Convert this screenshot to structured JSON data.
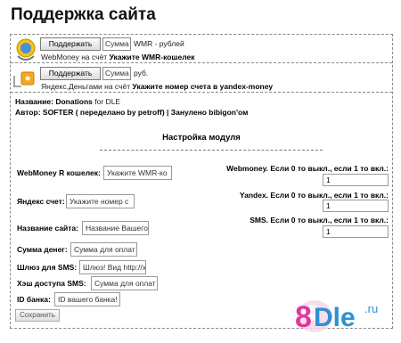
{
  "page": {
    "title": "Поддержка сайта"
  },
  "webmoney_pay": {
    "button": "Поддержать",
    "sum_placeholder": "Сумма",
    "currency": "WMR - рублей",
    "desc_prefix": "WebMoney на счёт",
    "desc_target": "Укажите WMR-кошелек",
    "icon": "webmoney-icon"
  },
  "yandex_pay": {
    "button": "Поддержать",
    "sum_placeholder": "Сумма",
    "currency": "руб.",
    "desc_prefix": "Яндекс.Деньгами на счёт",
    "desc_target": "Укажите номер счета в yandex-money",
    "icon": "yandex-money-icon"
  },
  "meta": {
    "name_label": "Название",
    "name_value": "Donations",
    "name_suffix": "for DLE",
    "author_label": "Автор",
    "author_value": "SOFTER ( переделано by petroff) | Зануленo bibigon'ом"
  },
  "settings": {
    "title": "Настройка модуля",
    "left_fields": [
      {
        "label": "WebMoney R кошелек:",
        "value": "Укажите WMR-ко"
      },
      {
        "label": "Яндекс счет:",
        "value": "Укажите номер с"
      },
      {
        "label": "Название сайта:",
        "value": "Название Вашего"
      },
      {
        "label": "Сумма денег:",
        "value": "Сумма для оплат"
      },
      {
        "label": "Шлюз для SMS:",
        "value": "Шлюз! Вид http://x"
      },
      {
        "label": "Хэш доступа SMS:",
        "value": "Сумма для оплат"
      },
      {
        "label": "ID банка:",
        "value": "ID вашего банка!"
      }
    ],
    "right_fields": [
      {
        "label": "Webmoney. Если 0 то выкл., если 1 то вкл.:",
        "value": "1"
      },
      {
        "label": "Yandex. Если 0 то выкл., если 1 то вкл.:",
        "value": "1"
      },
      {
        "label": "SMS. Если 0 то выкл., если 1 то вкл.:",
        "value": "1"
      }
    ],
    "save": "Сохранить"
  },
  "logo": {
    "text": "8Dle",
    "suffix": ".ru"
  },
  "colors": {
    "logo_pink": "#e0399a",
    "logo_blue": "#2e8fd6"
  }
}
